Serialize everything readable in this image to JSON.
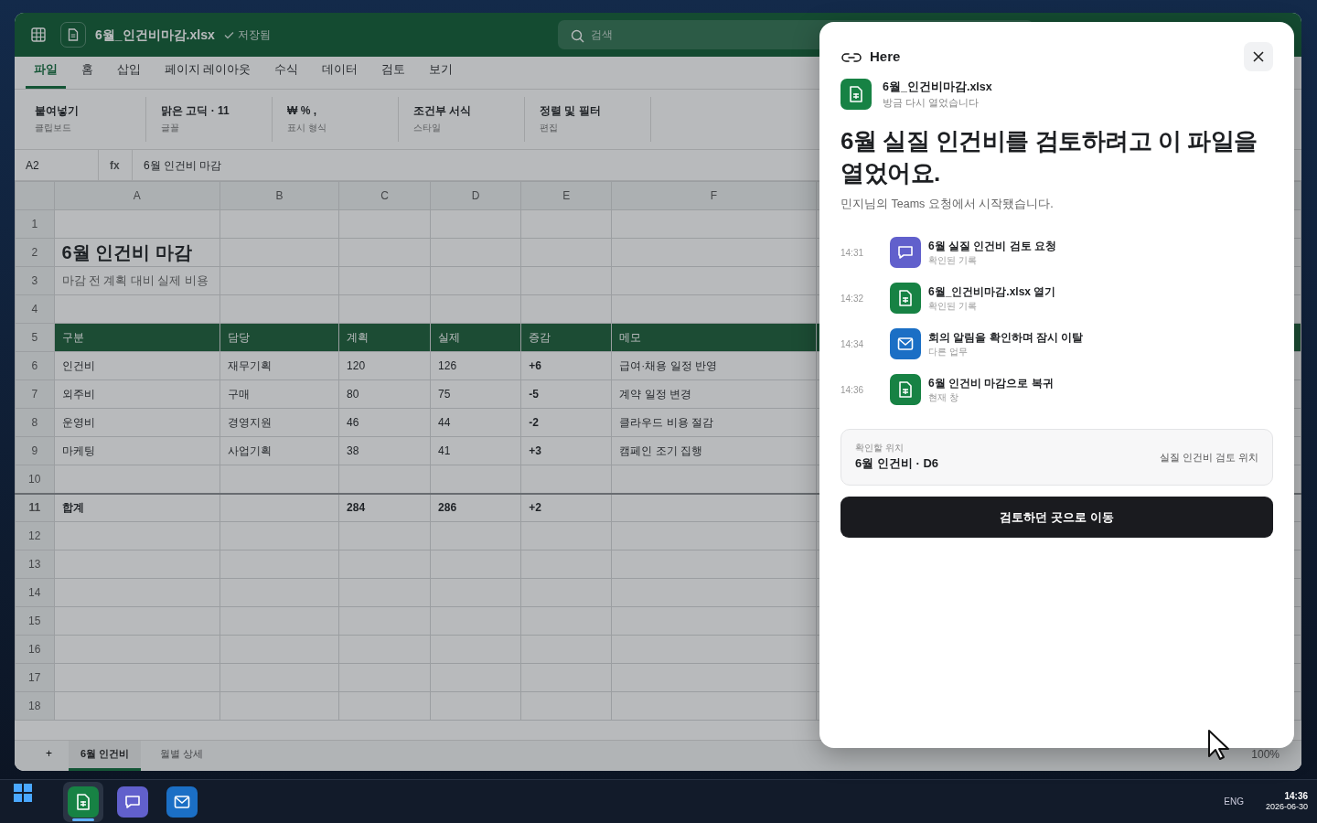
{
  "app": {
    "file_name": "6월_인건비마감.xlsx",
    "saved": "저장됨",
    "search": {
      "placeholder": "검색"
    }
  },
  "ribbon_tabs": [
    {
      "label": "파일",
      "selected": true
    },
    {
      "label": "홈",
      "selected": false
    },
    {
      "label": "삽입",
      "selected": false
    },
    {
      "label": "페이지 레이아웃",
      "selected": false
    },
    {
      "label": "수식",
      "selected": false
    },
    {
      "label": "데이터",
      "selected": false
    },
    {
      "label": "검토",
      "selected": false
    },
    {
      "label": "보기",
      "selected": false
    }
  ],
  "ribbon_groups": [
    {
      "label": "붙여넣기",
      "caption": "클립보드"
    },
    {
      "label": "맑은 고딕 · 11",
      "caption": "글꼴"
    },
    {
      "label": "₩ % ,",
      "caption": "표시 형식"
    },
    {
      "label": "조건부 서식",
      "caption": "스타일"
    },
    {
      "label": "정렬 및 필터",
      "caption": "편집"
    }
  ],
  "formula_bar": {
    "cell_ref": "A2",
    "fx": "fx",
    "value": "6월 인건비 마감"
  },
  "columns": [
    "A",
    "B",
    "C",
    "D",
    "E",
    "F"
  ],
  "rows": [
    {
      "number": "1",
      "kind": "blank",
      "cells": []
    },
    {
      "number": "2",
      "kind": "title",
      "cells": [
        "6월 인건비 마감"
      ]
    },
    {
      "number": "3",
      "kind": "subtitle",
      "cells": [
        "마감 전 계획 대비 실제 비용"
      ]
    },
    {
      "number": "4",
      "kind": "blank",
      "cells": []
    },
    {
      "number": "5",
      "kind": "header",
      "cells": [
        "구분",
        "담당",
        "계획",
        "실제",
        "증감",
        "메모"
      ]
    },
    {
      "number": "6",
      "kind": "data",
      "cells": [
        "인건비",
        "재무기획",
        "120",
        "126",
        "+6",
        "급여·채용 일정 반영"
      ]
    },
    {
      "number": "7",
      "kind": "data",
      "cells": [
        "외주비",
        "구매",
        "80",
        "75",
        "-5",
        "계약 일정 변경"
      ]
    },
    {
      "number": "8",
      "kind": "data",
      "cells": [
        "운영비",
        "경영지원",
        "46",
        "44",
        "-2",
        "클라우드 비용 절감"
      ]
    },
    {
      "number": "9",
      "kind": "data",
      "cells": [
        "마케팅",
        "사업기획",
        "38",
        "41",
        "+3",
        "캠페인 조기 집행"
      ]
    },
    {
      "number": "10",
      "kind": "blank",
      "cells": []
    },
    {
      "number": "11",
      "kind": "total",
      "cells": [
        "합계",
        "",
        "284",
        "286",
        "+2",
        ""
      ]
    },
    {
      "number": "12",
      "kind": "blank",
      "cells": []
    },
    {
      "number": "13",
      "kind": "blank",
      "cells": []
    },
    {
      "number": "14",
      "kind": "blank",
      "cells": []
    },
    {
      "number": "15",
      "kind": "blank",
      "cells": []
    },
    {
      "number": "16",
      "kind": "blank",
      "cells": []
    },
    {
      "number": "17",
      "kind": "blank",
      "cells": []
    },
    {
      "number": "18",
      "kind": "blank",
      "cells": []
    }
  ],
  "sheet_bar": {
    "add": "+",
    "tabs": [
      {
        "label": "6월 인건비",
        "selected": true
      },
      {
        "label": "월별 상세",
        "selected": false
      }
    ],
    "zoom": "100%"
  },
  "panel": {
    "brand": "Here",
    "file": {
      "name": "6월_인건비마감.xlsx",
      "status": "방금 다시 열었습니다"
    },
    "heading": "6월 실질 인건비를 검토하려고 이 파일을 열었어요.",
    "subtext": "민지님의 Teams 요청에서 시작됐습니다.",
    "timeline": [
      {
        "time": "14:31",
        "kind": "chat",
        "title": "6월 실질 인건비 검토 요청",
        "note": "확인된 기록"
      },
      {
        "time": "14:32",
        "kind": "sheet",
        "title": "6월_인건비마감.xlsx 열기",
        "note": "확인된 기록"
      },
      {
        "time": "14:34",
        "kind": "mail",
        "title": "회의 알림을 확인하며 잠시 이탈",
        "note": "다른 업무"
      },
      {
        "time": "14:36",
        "kind": "sheet",
        "title": "6월 인건비 마감으로 복귀",
        "note": "현재 창"
      }
    ],
    "location": {
      "label": "확인할 위치",
      "value": "6월 인건비 · D6",
      "note": "실질 인건비 검토 위치"
    },
    "button": "검토하던 곳으로 이동"
  },
  "taskbar": {
    "apps": [
      {
        "kind": "sheet",
        "active": true
      },
      {
        "kind": "chat",
        "active": false
      },
      {
        "kind": "mail",
        "active": false
      }
    ],
    "language": "ENG",
    "time": "14:36",
    "date": "2026-06-30"
  }
}
